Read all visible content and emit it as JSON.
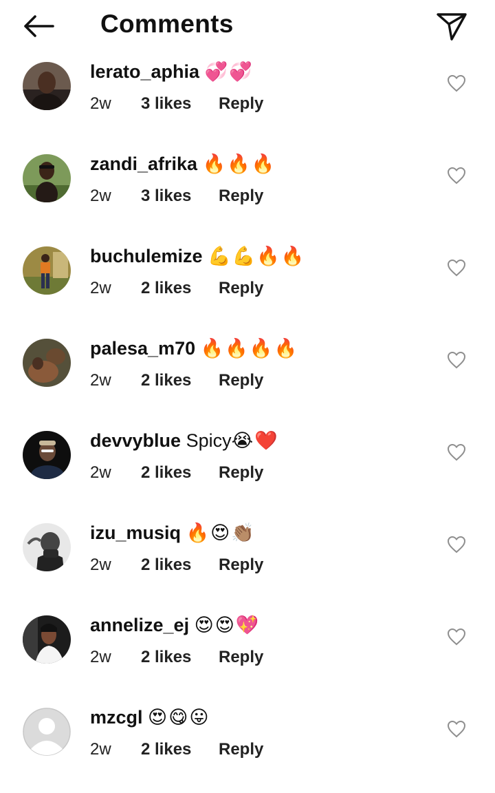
{
  "header": {
    "title": "Comments",
    "back_icon": "arrow-left-icon",
    "share_icon": "paper-plane-icon"
  },
  "comments": [
    {
      "username": "lerato_aphia",
      "text": "",
      "emojis": "💞💞",
      "time": "2w",
      "likes": "3 likes",
      "reply": "Reply"
    },
    {
      "username": "zandi_afrika",
      "text": "",
      "emojis": "🔥🔥🔥",
      "time": "2w",
      "likes": "3 likes",
      "reply": "Reply"
    },
    {
      "username": "buchulemize",
      "text": "",
      "emojis": "💪💪🔥🔥",
      "time": "2w",
      "likes": "2 likes",
      "reply": "Reply"
    },
    {
      "username": "palesa_m70",
      "text": "",
      "emojis": "🔥🔥🔥🔥",
      "time": "2w",
      "likes": "2 likes",
      "reply": "Reply"
    },
    {
      "username": "devvyblue",
      "text": "Spicy",
      "emojis": "😭❤️",
      "time": "2w",
      "likes": "2 likes",
      "reply": "Reply"
    },
    {
      "username": "izu_musiq",
      "text": "",
      "emojis": "🔥😍👏🏽",
      "time": "2w",
      "likes": "2 likes",
      "reply": "Reply"
    },
    {
      "username": "annelize_ej",
      "text": "",
      "emojis": "😍😍💖",
      "time": "2w",
      "likes": "2 likes",
      "reply": "Reply"
    },
    {
      "username": "mzcgl",
      "text": "",
      "emojis": "😍😋😛",
      "time": "2w",
      "likes": "2 likes",
      "reply": "Reply"
    }
  ],
  "colors": {
    "text": "#111111",
    "heart_outline": "#8e8e8e",
    "default_avatar_bg": "#dbdbdb"
  }
}
